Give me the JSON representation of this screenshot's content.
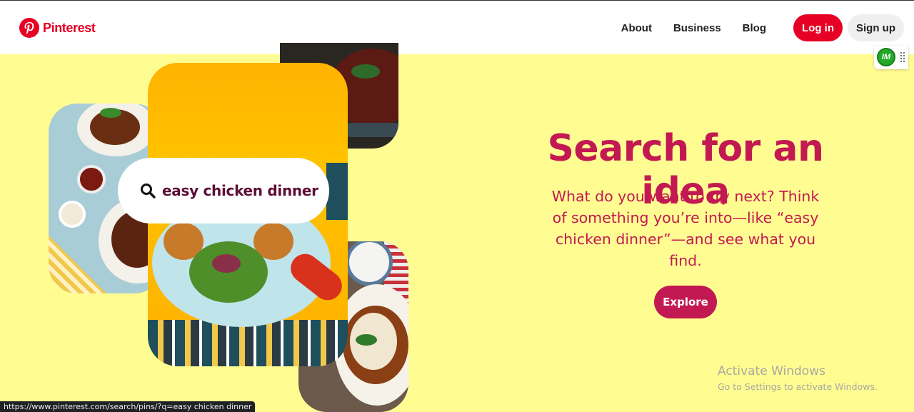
{
  "header": {
    "brand": "Pinterest",
    "nav": [
      "About",
      "Business",
      "Blog"
    ],
    "login_label": "Log in",
    "signup_label": "Sign up",
    "extension_label": "IM"
  },
  "collage": {
    "search_text": "easy chicken dinner"
  },
  "hero": {
    "title": "Search for an idea",
    "description": "What do you want to try next? Think of something you’re into—like “easy chicken dinner”—and see what you find.",
    "explore_label": "Explore"
  },
  "watermark": {
    "title": "Activate Windows",
    "subtitle": "Go to Settings to activate Windows."
  },
  "status_bar": {
    "url": "https://www.pinterest.com/search/pins/?q=easy chicken dinner"
  },
  "colors": {
    "brand_red": "#e60023",
    "hero_pink": "#c31952",
    "background_yellow": "#fffd92"
  }
}
